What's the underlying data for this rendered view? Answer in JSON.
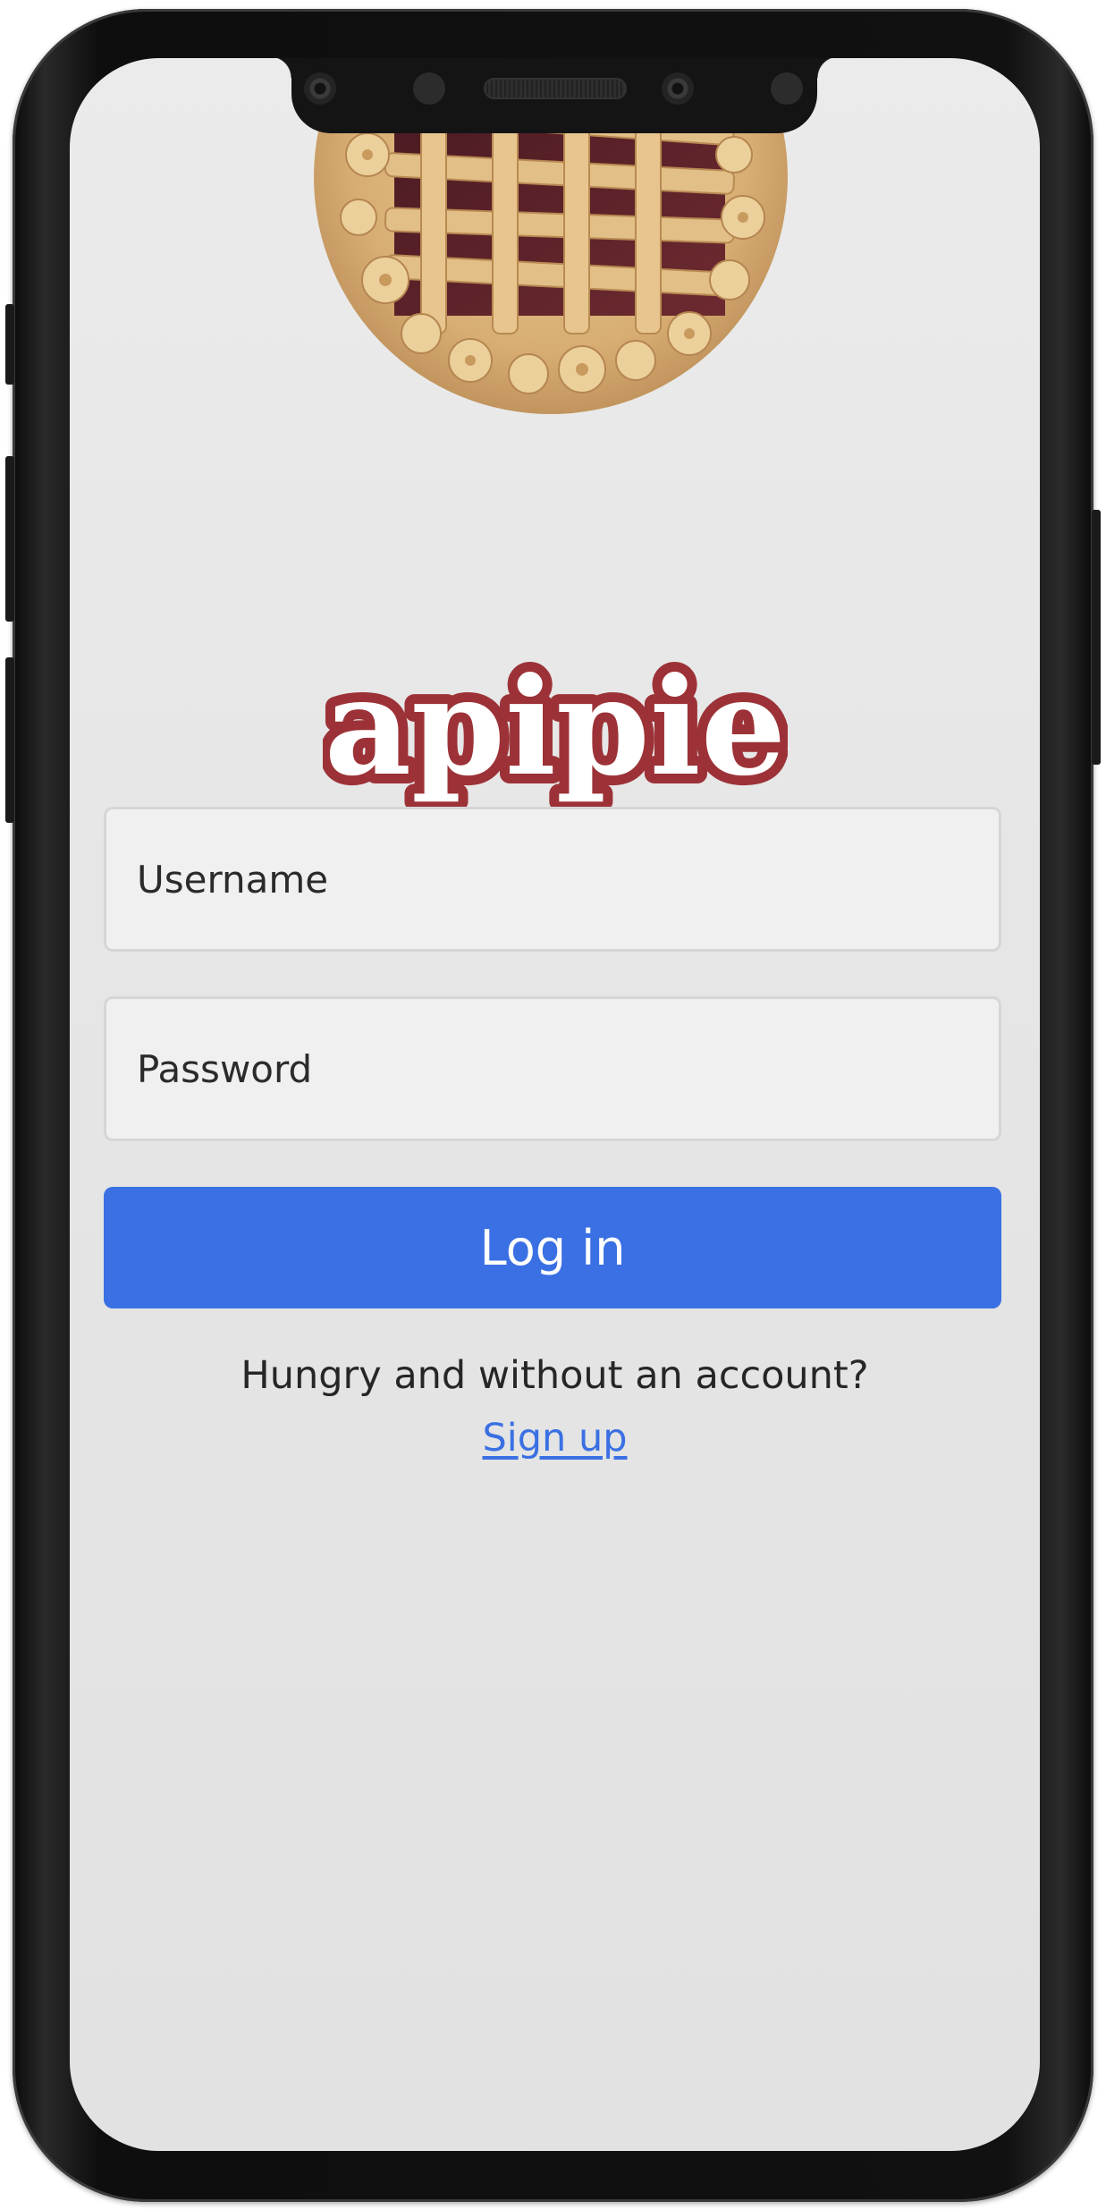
{
  "brand": {
    "logo_text": "apipie",
    "logo_fill": "#ffffff",
    "logo_outline": "#9c3237"
  },
  "hero": {
    "image_icon": "lattice-pie-photo"
  },
  "login_form": {
    "username_placeholder": "Username",
    "password_placeholder": "Password",
    "login_label": "Log in"
  },
  "signup": {
    "prompt": "Hungry and without an account?",
    "link_label": "Sign up"
  },
  "colors": {
    "primary": "#3a70e3",
    "background": "#e8e8e8",
    "field_background": "#f0f0f0",
    "text": "#262626"
  }
}
